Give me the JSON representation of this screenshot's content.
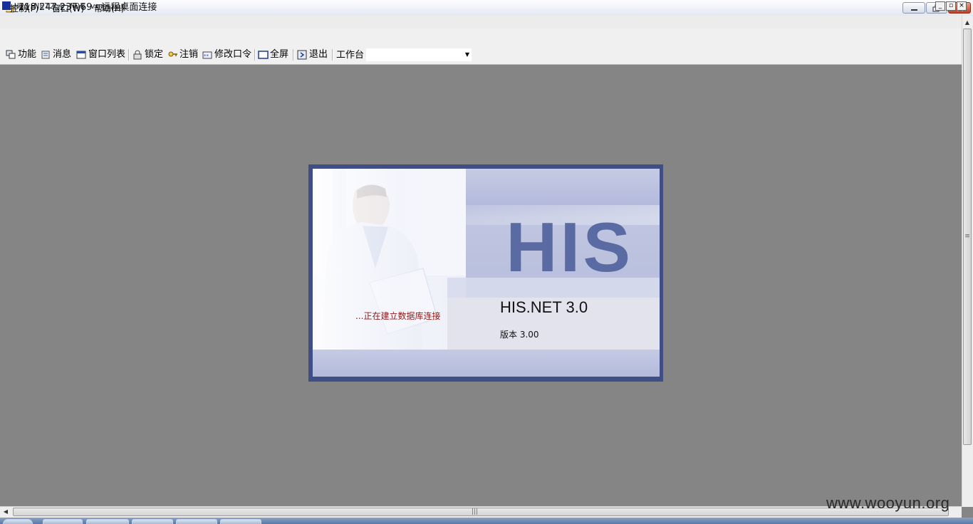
{
  "rdp_window": {
    "title": "218.247.237.69 - 远程桌面连接"
  },
  "app_window": {
    "title": "HIS.NET2.0 NDB version"
  },
  "menu": {
    "items": [
      "控制(F)",
      "窗口(W)",
      "帮助(H)"
    ]
  },
  "toolbar": {
    "buttons": [
      {
        "label": "功能",
        "icon": "function-icon"
      },
      {
        "label": "消息",
        "icon": "message-icon"
      },
      {
        "label": "窗口列表",
        "icon": "window-list-icon"
      },
      {
        "label": "锁定",
        "icon": "lock-icon"
      },
      {
        "label": "注销",
        "icon": "logout-key-icon"
      },
      {
        "label": "修改口令",
        "icon": "change-password-icon"
      },
      {
        "label": "全屏",
        "icon": "fullscreen-icon"
      },
      {
        "label": "退出",
        "icon": "exit-icon"
      }
    ],
    "workbench_label": "工作台",
    "workbench_value": ""
  },
  "splash": {
    "logo": "HIS",
    "product_name": "HIS.NET 3.0",
    "version": "版本 3.00",
    "status": "...正在建立数据库连接"
  },
  "watermark": "www.wooyun.org",
  "colors": {
    "desktop": "#868586",
    "splash_border": "#3f4f86",
    "logo": "#5a6aa3",
    "status_text": "#8b1a1a"
  }
}
